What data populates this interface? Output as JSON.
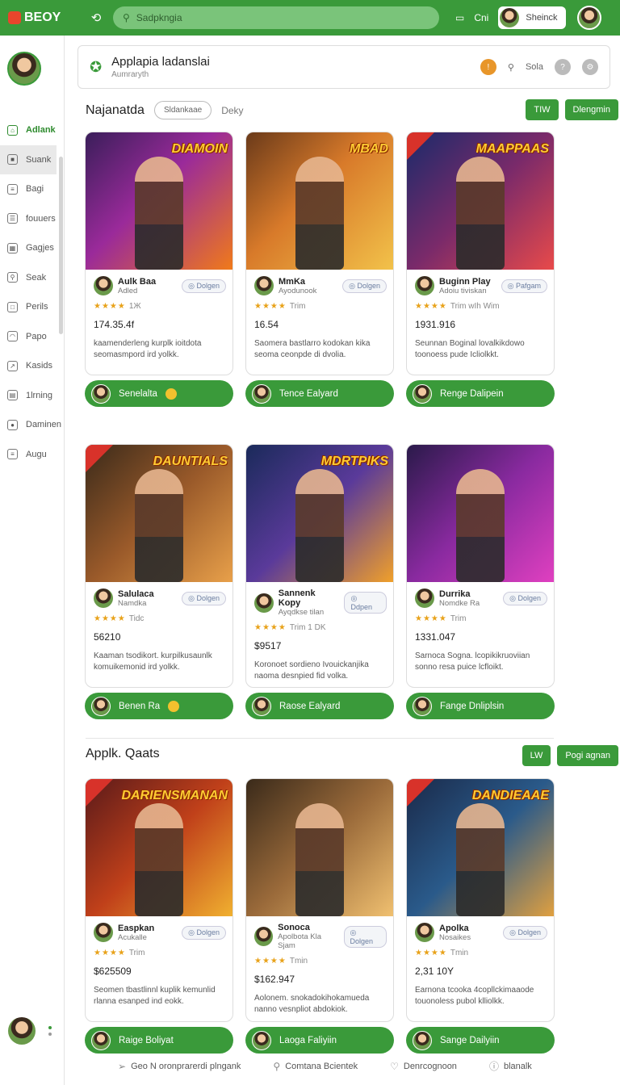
{
  "app": {
    "logo": "BEOY",
    "icons": [
      "brand-mark-icon",
      "refresh-icon",
      "chat-icon"
    ]
  },
  "search": {
    "placeholder": "Sadpkngia"
  },
  "topbar": {
    "text_link": "Cni",
    "user_name": "Sheinck"
  },
  "sidebar": {
    "items": [
      {
        "label": "Adlank",
        "icon": "home-icon",
        "state": "active"
      },
      {
        "label": "Suank",
        "icon": "square-icon",
        "state": "hover"
      },
      {
        "label": "Bagi",
        "icon": "doc-icon"
      },
      {
        "label": "fouuers",
        "icon": "list-icon"
      },
      {
        "label": "Gagjes",
        "icon": "grid-icon"
      },
      {
        "label": "Seak",
        "icon": "search-icon"
      },
      {
        "label": "Perils",
        "icon": "page-icon"
      },
      {
        "label": "Papo",
        "icon": "wifi-icon"
      },
      {
        "label": "Kasids",
        "icon": "share-icon"
      },
      {
        "label": "1lrning",
        "icon": "chart-icon"
      },
      {
        "label": "Daminen",
        "icon": "user-icon"
      },
      {
        "label": "Augu",
        "icon": "doc-icon"
      }
    ]
  },
  "header": {
    "title": "Applapia ladanslai",
    "subtitle": "Aumraryth",
    "right_label": "Sola"
  },
  "section1": {
    "title": "Najanatda",
    "pill": "Sldankaae",
    "link": "Deky",
    "buttons": [
      "TIW",
      "Dlengmin"
    ]
  },
  "section2": {
    "title": "Applk. Qaats",
    "buttons": [
      "LW",
      "Pogi agnan"
    ]
  },
  "colors": {
    "accent": "#3a9a3a",
    "star": "#e8a21a",
    "badge": "#d8322a"
  },
  "cards": [
    {
      "title_art": "DIAMOIN",
      "name": "Aulk Baa",
      "developer": "Adled",
      "tag": "Dolgen",
      "rating": "1Ж",
      "number": "174.35.4f",
      "desc": "kaamenderleng kurplk ioitdota seomasmpord ird yolkk.",
      "button": "Senelalta",
      "coin": true
    },
    {
      "title_art": "MBAD",
      "name": "MmKa",
      "developer": "Ayodunook",
      "tag": "Dolgen",
      "rating": "Trim",
      "number": "16.54",
      "desc": "Saomera bastlarro kodokan kika seoma ceonpde di dvolia.",
      "button": "Tence Ealyard",
      "coin": false
    },
    {
      "title_art": "MAAPPAAS",
      "name": "Buginn Play",
      "developer": "Adoiu tiviskan",
      "tag": "Pafgam",
      "rating": "Trim wIh Wim",
      "number": "1931.916",
      "desc": "Seunnan Boginal lovalkikdowo toonoess pude Icliolkkt.",
      "button": "Renge Dalipein",
      "coin": false
    },
    {
      "title_art": "DAUNTIALS",
      "name": "Salulaca",
      "developer": "Namdka",
      "tag": "Dolgen",
      "rating": "Tidc",
      "number": "56210",
      "desc": "Kaaman tsodikort. kurpilkusaunlk komuikemonid ird yolkk.",
      "button": "Benen Ra",
      "coin": true
    },
    {
      "title_art": "MDRTPIKS",
      "name": "Sannenk Kopy",
      "developer": "Ayqdkse tilan",
      "tag": "Ddpen",
      "rating": "Trim 1 DK",
      "number": "$9517",
      "desc": "Koronoet sordieno Ivouickanjika naoma desnpied fid volka.",
      "button": "Raose Ealyard",
      "coin": false
    },
    {
      "title_art": "",
      "name": "Durrika",
      "developer": "Nomdke Ra",
      "tag": "Dolgen",
      "rating": "Trim",
      "number": "1331.047",
      "desc": "Sarnoca Sogna. lcopikikruoviian sonno resa puice lcfloikt.",
      "button": "Fange Dnliplsin",
      "coin": false
    },
    {
      "title_art": "DARIENSMANAN",
      "name": "Easpkan",
      "developer": "Acukalle",
      "tag": "Dolgen",
      "rating": "Trim",
      "number": "$625509",
      "desc": "Seomen tbastlinnl kuplik kemunlid rlanna esanped ind eokk.",
      "button": "Raige Boliyat",
      "coin": false
    },
    {
      "title_art": "",
      "name": "Sonoca",
      "developer": "Apolbota Kla Sjam",
      "tag": "Dolgen",
      "rating": "Tmin",
      "number": "$162.947",
      "desc": "Aolonem. snokadokihokamueda nanno vesnpliot abdokiok.",
      "button": "Laoga Faliyiin",
      "coin": false
    },
    {
      "title_art": "DANDIEAAE",
      "name": "Apolka",
      "developer": "Nosaikes",
      "tag": "Dolgen",
      "rating": "Tmin",
      "number": "2,31 10Y",
      "desc": "Earnona tcooka 4copllckimaaode touonoless pubol klliolkk.",
      "button": "Sange Dailyiin",
      "coin": false
    }
  ],
  "footer": {
    "items": [
      {
        "icon": "send-icon",
        "label": "Geo N oronprarerdi plngank"
      },
      {
        "icon": "search-icon",
        "label": "Comtana Bcientek"
      },
      {
        "icon": "heart-icon",
        "label": "Denrcognoon"
      },
      {
        "icon": "info-icon",
        "label": "blanalk"
      }
    ]
  }
}
